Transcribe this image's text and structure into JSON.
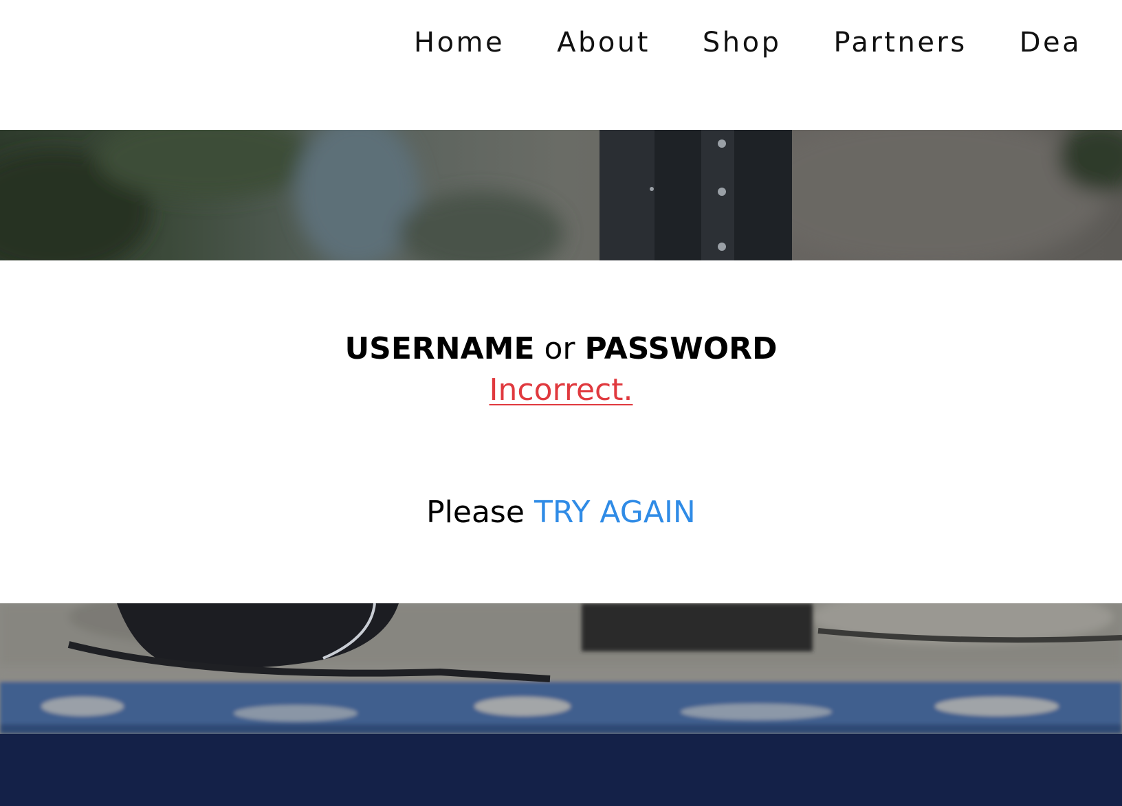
{
  "nav": {
    "items": [
      {
        "label": "Home"
      },
      {
        "label": "About"
      },
      {
        "label": "Shop"
      },
      {
        "label": "Partners"
      },
      {
        "label": "Dea"
      }
    ]
  },
  "message": {
    "username": "USERNAME",
    "or": "or",
    "password": "PASSWORD",
    "incorrect": "Incorrect.",
    "please": "Please",
    "try_again": "TRY AGAIN"
  },
  "colors": {
    "error_red": "#e0393e",
    "link_blue": "#2f8be6",
    "footer_navy": "#142148"
  }
}
